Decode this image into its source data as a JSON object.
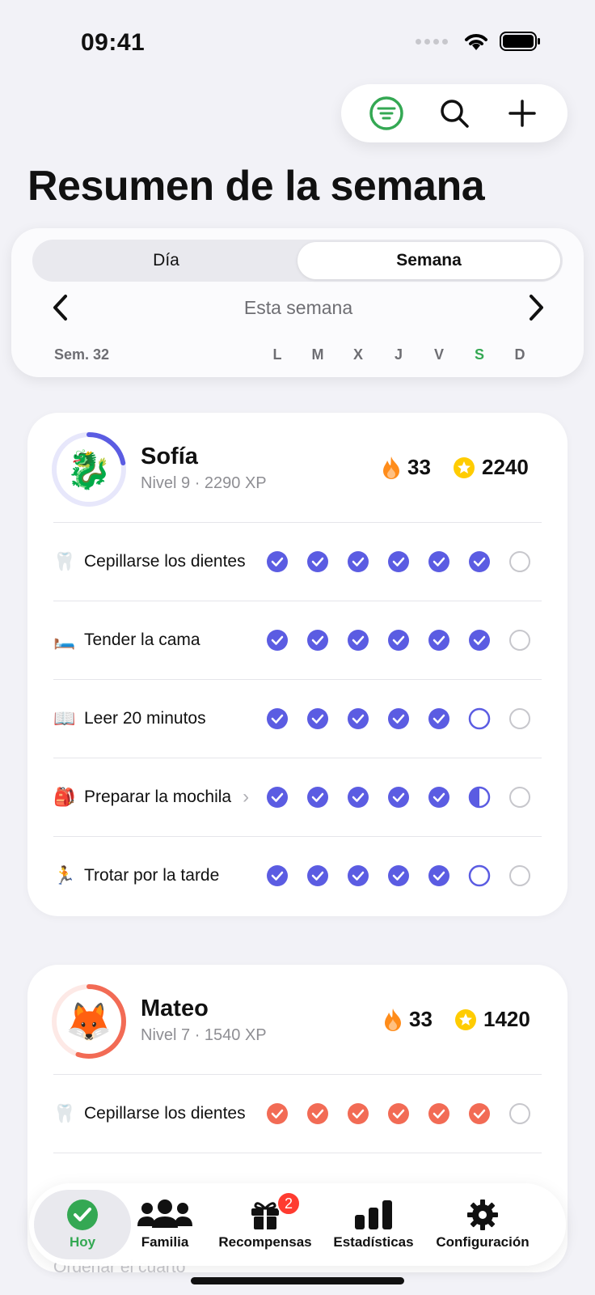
{
  "status_bar": {
    "time": "09:41"
  },
  "toolbar": {
    "filter_icon": "filter-icon",
    "search_icon": "search-icon",
    "add_icon": "plus-icon"
  },
  "title": "Resumen de la semana",
  "segments": {
    "day": "Día",
    "week": "Semana",
    "selected": "week"
  },
  "week_nav": {
    "label": "Esta semana",
    "week_number": "Sem. 32"
  },
  "days": [
    "L",
    "M",
    "X",
    "J",
    "V",
    "S",
    "D"
  ],
  "today_index": 5,
  "colors": {
    "sofia": "#5b5ce2",
    "mateo": "#f26b55",
    "today": "#34a853",
    "streak": "#ff8c1a",
    "star": "#ffcc00"
  },
  "kids": [
    {
      "name": "Sofía",
      "level": "Nivel 9 · 2290 XP",
      "avatar_icon": "dragon-icon",
      "level_progress": 0.22,
      "streak": "33",
      "stars": "2240",
      "tasks": [
        {
          "emoji": "🦷",
          "label": "Cepillarse los dientes",
          "days": [
            "done",
            "done",
            "done",
            "done",
            "done",
            "done",
            "empty"
          ]
        },
        {
          "emoji": "🛏️",
          "label": "Tender la cama",
          "days": [
            "done",
            "done",
            "done",
            "done",
            "done",
            "done",
            "empty"
          ]
        },
        {
          "emoji": "📖",
          "label": "Leer 20 minutos",
          "days": [
            "done",
            "done",
            "done",
            "done",
            "done",
            "pending",
            "empty"
          ]
        },
        {
          "emoji": "🎒",
          "label": "Preparar la mochila",
          "has_chevron": true,
          "days": [
            "done",
            "done",
            "done",
            "done",
            "done",
            "half",
            "empty"
          ]
        },
        {
          "emoji": "🏃",
          "label": "Trotar por la tarde",
          "days": [
            "done",
            "done",
            "done",
            "done",
            "done",
            "pending",
            "empty"
          ]
        }
      ]
    },
    {
      "name": "Mateo",
      "level": "Nivel 7 · 1540 XP",
      "avatar_icon": "fox-icon",
      "level_progress": 0.55,
      "streak": "33",
      "stars": "1420",
      "tasks": [
        {
          "emoji": "🦷",
          "label": "Cepillarse los dientes",
          "days": [
            "done",
            "done",
            "done",
            "done",
            "done",
            "done",
            "empty"
          ]
        }
      ]
    }
  ],
  "tabs": [
    {
      "label": "Hoy",
      "icon": "checkmark-circle-icon",
      "active": true
    },
    {
      "label": "Familia",
      "icon": "people-icon"
    },
    {
      "label": "Recompensas",
      "icon": "gift-icon",
      "badge": "2"
    },
    {
      "label": "Estadísticas",
      "icon": "bar-chart-icon"
    },
    {
      "label": "Configuración",
      "icon": "gear-icon"
    }
  ],
  "peek_row": {
    "label": "Ordenar el cuarto"
  }
}
